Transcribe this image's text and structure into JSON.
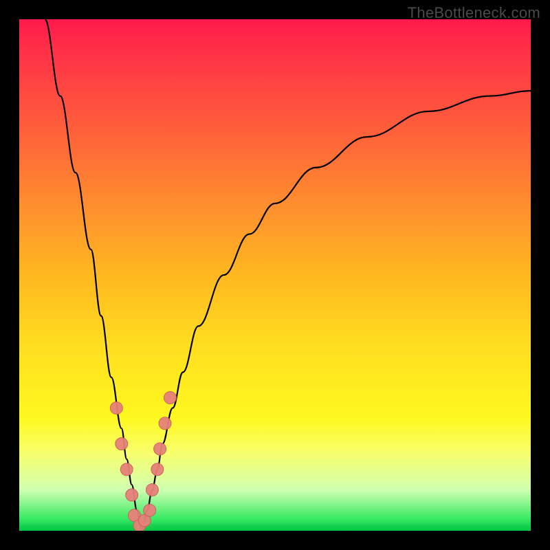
{
  "watermark": "TheBottleneck.com",
  "chart_data": {
    "type": "line",
    "title": "",
    "xlabel": "",
    "ylabel": "",
    "xlim": [
      0,
      100
    ],
    "ylim": [
      0,
      100
    ],
    "series": [
      {
        "name": "left-branch",
        "x": [
          5,
          8,
          11,
          14,
          16,
          18,
          20,
          21,
          22,
          23,
          24
        ],
        "values": [
          100,
          85,
          70,
          55,
          42,
          30,
          20,
          14,
          9,
          4,
          0
        ]
      },
      {
        "name": "right-branch",
        "x": [
          24,
          25,
          26,
          27,
          28,
          30,
          32,
          35,
          40,
          45,
          50,
          58,
          68,
          80,
          92,
          100
        ],
        "values": [
          0,
          4,
          8,
          12,
          17,
          24,
          31,
          40,
          50,
          58,
          64,
          71,
          77,
          82,
          85,
          86
        ]
      }
    ],
    "points": {
      "name": "highlight-points",
      "x": [
        19,
        20,
        21,
        22,
        22.5,
        23.5,
        24.5,
        25.5,
        26,
        27,
        27.5,
        28.5,
        29.5
      ],
      "values": [
        24,
        17,
        12,
        7,
        3,
        1,
        2,
        4,
        8,
        12,
        16,
        21,
        26
      ],
      "color_fill": "#e6817a",
      "color_stroke": "#c96058",
      "radius": 9
    },
    "colors": {
      "gradient_top": "#ff1a4c",
      "gradient_mid": "#ffe020",
      "gradient_bottom": "#00c840",
      "curve": "#000000"
    }
  }
}
